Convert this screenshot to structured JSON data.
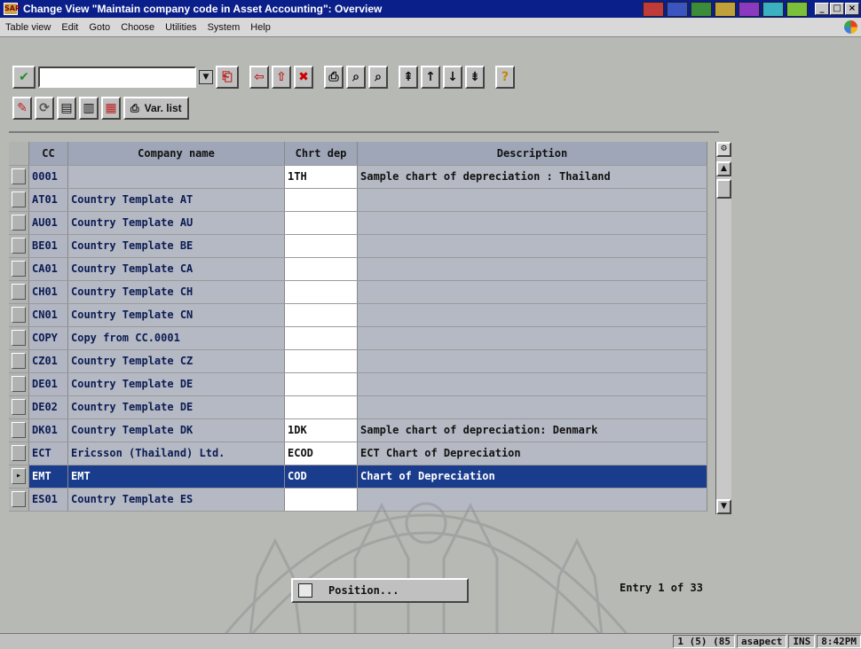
{
  "window": {
    "title": "Change View \"Maintain company code in Asset Accounting\": Overview",
    "window_buttons": [
      "_",
      "□",
      "×"
    ]
  },
  "menu": [
    "Table view",
    "Edit",
    "Goto",
    "Choose",
    "Utilities",
    "System",
    "Help"
  ],
  "toolbar": {
    "var_list_label": "Var. list"
  },
  "table": {
    "headers": [
      "CC",
      "Company name",
      "Chrt dep",
      "Description"
    ],
    "rows": [
      {
        "cc": "0001",
        "name": "",
        "chrt": "1TH",
        "desc": "Sample chart of depreciation : Thailand"
      },
      {
        "cc": "AT01",
        "name": "Country Template AT",
        "chrt": "",
        "desc": ""
      },
      {
        "cc": "AU01",
        "name": "Country Template AU",
        "chrt": "",
        "desc": ""
      },
      {
        "cc": "BE01",
        "name": "Country Template BE",
        "chrt": "",
        "desc": ""
      },
      {
        "cc": "CA01",
        "name": "Country Template CA",
        "chrt": "",
        "desc": ""
      },
      {
        "cc": "CH01",
        "name": "Country Template CH",
        "chrt": "",
        "desc": ""
      },
      {
        "cc": "CN01",
        "name": "Country Template CN",
        "chrt": "",
        "desc": ""
      },
      {
        "cc": "COPY",
        "name": "Copy from CC.0001",
        "chrt": "",
        "desc": ""
      },
      {
        "cc": "CZ01",
        "name": "Country Template CZ",
        "chrt": "",
        "desc": ""
      },
      {
        "cc": "DE01",
        "name": "Country Template DE",
        "chrt": "",
        "desc": ""
      },
      {
        "cc": "DE02",
        "name": "Country Template DE",
        "chrt": "",
        "desc": ""
      },
      {
        "cc": "DK01",
        "name": "Country Template DK",
        "chrt": "1DK",
        "desc": "Sample chart of depreciation: Denmark"
      },
      {
        "cc": "ECT",
        "name": "Ericsson (Thailand) Ltd.",
        "chrt": "ECOD",
        "desc": "ECT Chart of Depreciation"
      },
      {
        "cc": "EMT",
        "name": "EMT",
        "chrt": "COD",
        "desc": "Chart of Depreciation"
      },
      {
        "cc": "ES01",
        "name": "Country Template ES",
        "chrt": "",
        "desc": ""
      }
    ]
  },
  "position_button_label": "Position...",
  "entry_text": "Entry 1 of 33",
  "status": [
    "1 (5) (85",
    "asapect",
    "INS",
    "8:42PM"
  ],
  "colors": {
    "title_bar": "#0a1f8a",
    "selected_row": "#1a3c8c",
    "header_bg": "#9ea6b7"
  }
}
